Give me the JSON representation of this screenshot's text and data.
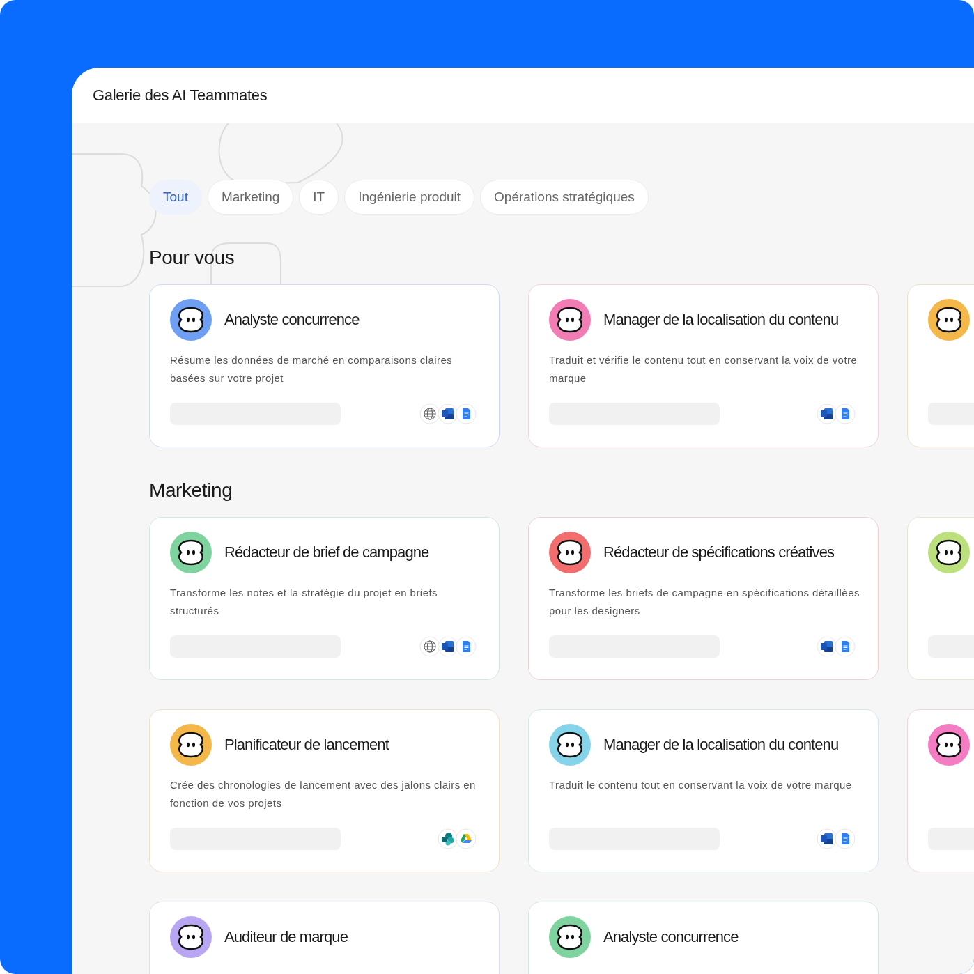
{
  "window": {
    "title": "Galerie des AI Teammates"
  },
  "tabs": [
    {
      "label": "Tout",
      "selected": true
    },
    {
      "label": "Marketing",
      "selected": false
    },
    {
      "label": "IT",
      "selected": false
    },
    {
      "label": "Ingénierie produit",
      "selected": false
    },
    {
      "label": "Opérations stratégiques",
      "selected": false
    }
  ],
  "sections": [
    {
      "title": "Pour vous",
      "cards": [
        {
          "title": "Analyste concurrence",
          "description": "Résume les données de marché en comparaisons claires basées sur votre projet",
          "color": "#6e9ff2",
          "integrations": [
            {
              "kind": "globe"
            },
            {
              "kind": "word"
            },
            {
              "kind": "docs"
            }
          ]
        },
        {
          "title": "Manager de la localisation du contenu",
          "description": "Traduit et vérifie le contenu tout en conservant la voix de votre marque",
          "color": "#f27db5",
          "integrations": [
            {
              "kind": "word"
            },
            {
              "kind": "docs"
            }
          ]
        },
        {
          "color": "#f4b84a"
        }
      ]
    },
    {
      "title": "Marketing",
      "cards": [
        {
          "title": "Rédacteur de brief de campagne",
          "description": "Transforme les notes et la stratégie du projet en briefs structurés",
          "color": "#7fd39f",
          "integrations": [
            {
              "kind": "globe"
            },
            {
              "kind": "word"
            },
            {
              "kind": "docs"
            }
          ]
        },
        {
          "title": "Rédacteur de spécifications créatives",
          "description": "Transforme les briefs de campagne en spécifications détaillées pour les designers",
          "color": "#f26d6d",
          "integrations": [
            {
              "kind": "word"
            },
            {
              "kind": "docs"
            }
          ]
        },
        {
          "color": "#bce07e"
        },
        {
          "title": "Planificateur de lancement",
          "description": "Crée des chronologies de lancement avec des jalons clairs en fonction de vos projets",
          "color": "#f4b84a",
          "integrations": [
            {
              "kind": "sharepoint"
            },
            {
              "kind": "drive"
            }
          ]
        },
        {
          "title": "Manager de la localisation du contenu",
          "description": "Traduit le contenu tout en conservant la voix de votre marque",
          "color": "#86d4ea",
          "integrations": [
            {
              "kind": "word"
            },
            {
              "kind": "docs"
            }
          ]
        },
        {
          "color": "#f47cc2"
        },
        {
          "title": "Auditeur de marque",
          "color": "#b9a6f2"
        },
        {
          "title": "Analyste concurrence",
          "color": "#7fd39f"
        }
      ]
    }
  ]
}
